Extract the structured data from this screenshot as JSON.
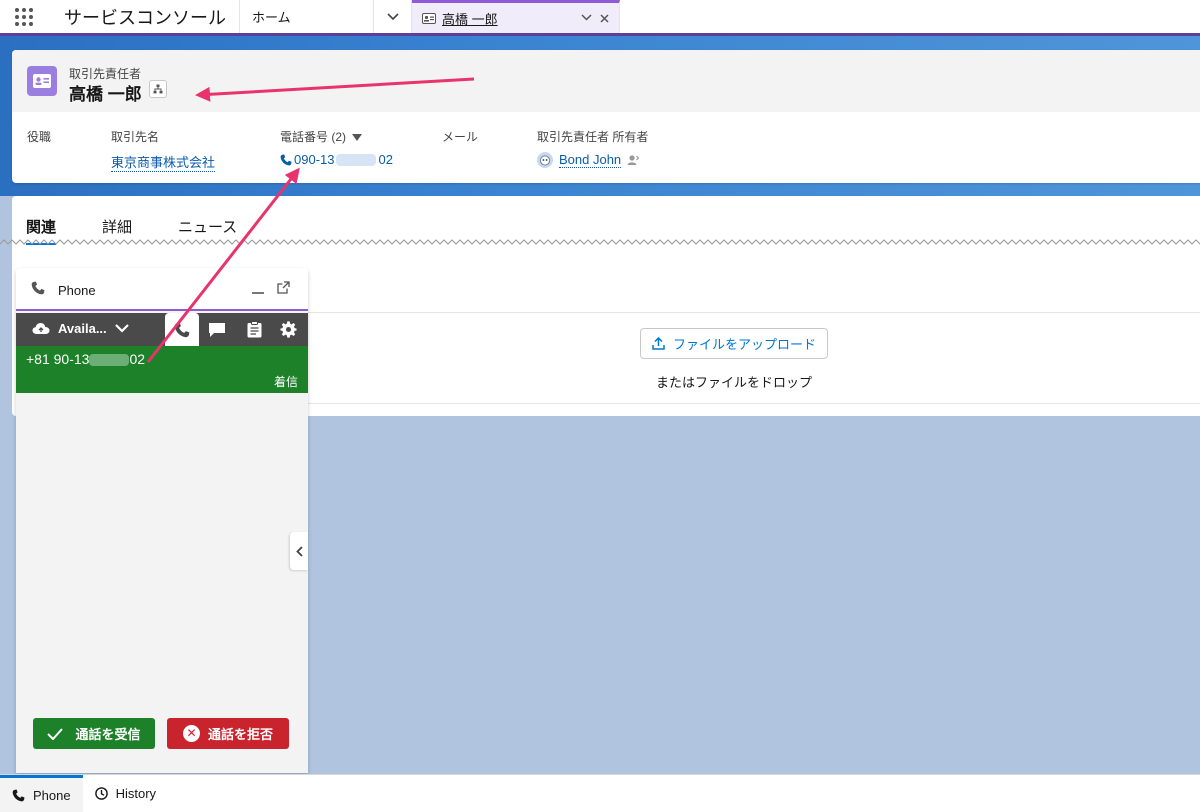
{
  "topbar": {
    "app_name": "サービスコンソール",
    "home_tab": "ホーム",
    "active_tab": "高橋 一郎"
  },
  "record": {
    "object_type": "取引先責任者",
    "name": "高橋 一郎",
    "fields": {
      "title_label": "役職",
      "account_label": "取引先名",
      "account_value": "東京商事株式会社",
      "phone_label": "電話番号 (2)",
      "phone_value": "090-13",
      "phone_value_end": "02",
      "email_label": "メール",
      "owner_label": "取引先責任者 所有者",
      "owner_value": "Bond John"
    }
  },
  "tabs": [
    "関連",
    "詳細",
    "ニュース"
  ],
  "upload": {
    "button_label": "ファイルをアップロード",
    "drop_text": "またはファイルをドロップ"
  },
  "phone_panel": {
    "title": "Phone",
    "status": "Availa...",
    "incoming_number_start": "+81 90-13",
    "incoming_number_end": "02",
    "call_state": "着信",
    "accept_label": "通話を受信",
    "reject_label": "通話を拒否"
  },
  "utility_bar": {
    "phone_label": "Phone",
    "history_label": "History"
  },
  "colors": {
    "brand_purple": "#5a3f9d",
    "accept_green": "#1d8129",
    "reject_red": "#c9232d",
    "link_blue": "#0b5cab",
    "arrow_pink": "#e8336d"
  }
}
